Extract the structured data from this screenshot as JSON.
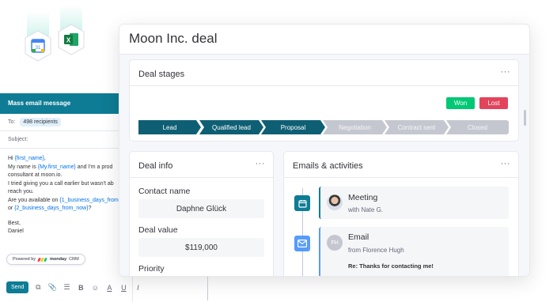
{
  "apps": [
    {
      "name": "google-calendar",
      "glyph": "31"
    },
    {
      "name": "microsoft-excel",
      "glyph": "X"
    }
  ],
  "email": {
    "header": "Mass email message",
    "to_label": "To:",
    "recipients": "498 recipients",
    "subject_label": "Subject:",
    "body": {
      "greet_pre": "Hi ",
      "greet_var": "{first_name}",
      "greet_post": ",",
      "line2_pre": "My name is ",
      "line2_var": "{My.first_name}",
      "line2_post": " and I'm a prod",
      "line3": "consultant at moon.io.",
      "line4": "I tried giving you a call earlier but wasn't ab",
      "line5": "reach you.",
      "line6_pre": "Are you available on ",
      "line6_var": "{1_business_days_from",
      "line7_pre": "or ",
      "line7_var": "{2_business_days_from_now}",
      "line7_post": "?",
      "sign1": "Best,",
      "sign2": "Daniel"
    },
    "powered_by": "Powered by",
    "brand": "monday",
    "brand_suffix": "CRM",
    "send_label": "Send",
    "toolbar_icons": [
      "variable-icon",
      "attach-icon",
      "list-icon",
      "bold-icon",
      "emoji-icon",
      "font-color-icon",
      "underline-icon",
      "italic-icon"
    ]
  },
  "deal": {
    "title": "Moon Inc. deal",
    "stages_card": {
      "title": "Deal stages",
      "menu": "···",
      "won_label": "Won",
      "lost_label": "Lost",
      "stages": [
        {
          "label": "Lead",
          "state": "active"
        },
        {
          "label": "Qualified lead",
          "state": "active"
        },
        {
          "label": "Proposal",
          "state": "active"
        },
        {
          "label": "Negotiation",
          "state": "inactive"
        },
        {
          "label": "Contract sent",
          "state": "inactive"
        },
        {
          "label": "Closed",
          "state": "inactive"
        }
      ]
    },
    "info_card": {
      "title": "Deal info",
      "menu": "···",
      "contact_label": "Contact name",
      "contact_value": "Daphne Glück",
      "value_label": "Deal value",
      "value_value": "$119,000",
      "priority_label": "Priority"
    },
    "activities_card": {
      "title": "Emails & activities",
      "menu": "···",
      "meeting": {
        "title": "Meeting",
        "sub": "with Nate G."
      },
      "email": {
        "title": "Email",
        "initials": "FH",
        "sub": "from Florence Hugh",
        "subject": "Re: Thanks for contacting me!"
      }
    }
  },
  "colors": {
    "teal": "#0e7c94",
    "dark_teal": "#0e5f74",
    "won": "#00c875",
    "lost": "#e2445c",
    "grey": "#c5c7d0",
    "blue": "#579bfc"
  }
}
